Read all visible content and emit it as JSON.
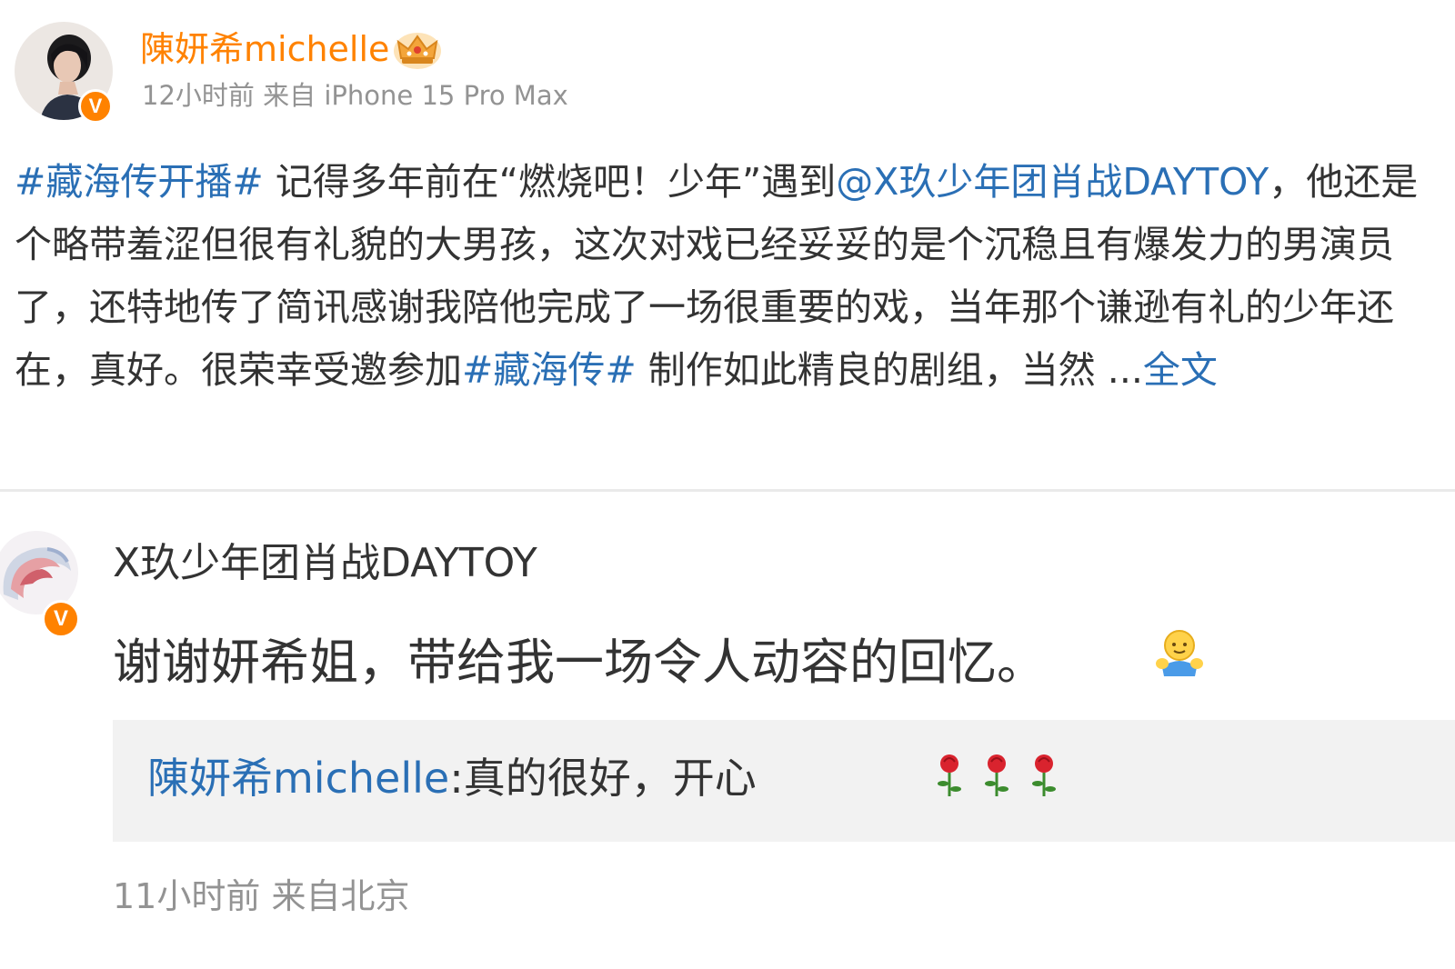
{
  "post": {
    "author": "陳妍希michelle",
    "time": "12小时前",
    "source_prefix": "来自",
    "source": "iPhone 15 Pro Max",
    "body": {
      "hashtag1": "#藏海传开播#",
      "text1": " 记得多年前在“燃烧吧！少年”遇到",
      "mention": "@X玖少年团肖战DAYTOY",
      "text2": "，他还是个略带羞涩但很有礼貌的大男孩，这次对戏已经妥妥的是个沉稳且有爆发力的男演员了，还特地传了简讯感谢我陪他完成了一场很重要的戏，当年那个谦逊有礼的少年还在，真好。很荣幸受邀参加",
      "hashtag2": "#藏海传#",
      "text3": " 制作如此精良的剧组，当然 ...",
      "more_link": "全文"
    }
  },
  "reply": {
    "author": "X玖少年团肖战DAYTOY",
    "text": "谢谢妍希姐，带给我一场令人动容的回忆。",
    "emoji": "hug-emoji",
    "quote": {
      "author": "陳妍希michelle",
      "separator": ":",
      "text": "真的很好，开心",
      "emoji": "rose-emoji-x3"
    },
    "time": "11小时前",
    "location": "来自北京"
  },
  "colors": {
    "brand_orange": "#ff8200",
    "link_blue": "#2a6fb5",
    "meta_gray": "#939393",
    "quote_bg": "#f2f2f2"
  }
}
